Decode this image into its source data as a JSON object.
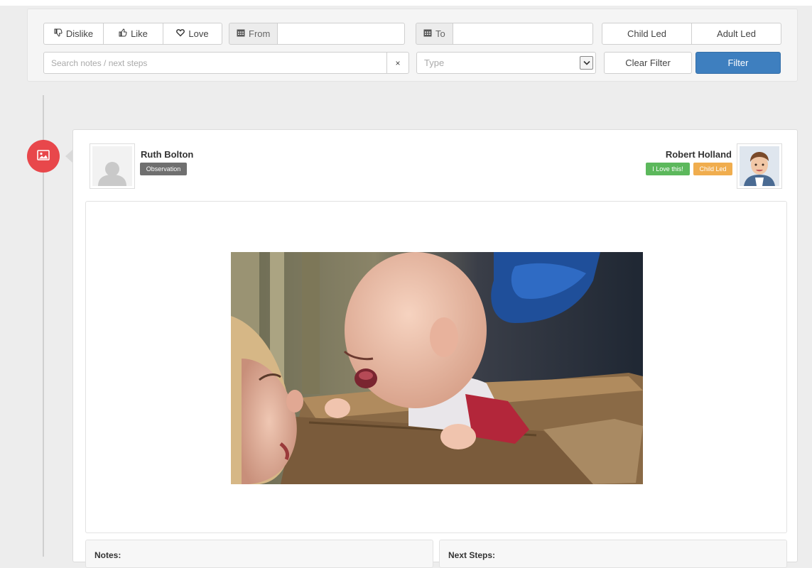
{
  "filters": {
    "reactions": [
      {
        "label": "Dislike",
        "icon": "thumbs-down-icon"
      },
      {
        "label": "Like",
        "icon": "thumbs-up-icon"
      },
      {
        "label": "Love",
        "icon": "heart-icon"
      }
    ],
    "from_label": "From",
    "from_value": "",
    "to_label": "To",
    "to_value": "",
    "child_led_label": "Child Led",
    "adult_led_label": "Adult Led",
    "search_placeholder": "Search notes / next steps",
    "search_value": "",
    "clear_search_glyph": "×",
    "type_placeholder": "Type",
    "clear_filter_label": "Clear Filter",
    "filter_label": "Filter",
    "accent_color": "#3e7fbf"
  },
  "timeline": {
    "badge_icon": "image-icon",
    "badge_color": "#e8474b"
  },
  "entry": {
    "author_name": "Ruth Bolton",
    "entry_type": "Observation",
    "child_name": "Robert Holland",
    "reaction_label": "I Love this!",
    "led_label": "Child Led",
    "notes_label": "Notes:",
    "next_steps_label": "Next Steps:"
  }
}
